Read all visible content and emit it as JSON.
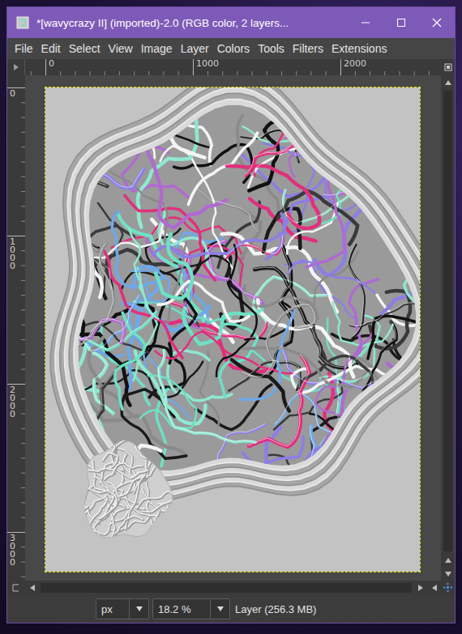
{
  "window": {
    "title": "*[wavycrazy II] (imported)-2.0 (RGB color, 2 layers..."
  },
  "menu": [
    "File",
    "Edit",
    "Select",
    "View",
    "Image",
    "Layer",
    "Colors",
    "Tools",
    "Filters",
    "Extensions"
  ],
  "rulers": {
    "horizontal": [
      "0",
      "1000",
      "2000"
    ],
    "vertical": [
      "0",
      "1000",
      "2000",
      "3000"
    ]
  },
  "status_bar": {
    "unit": "px",
    "zoom": "18.2 %",
    "info": "Layer (256.3 MB)"
  }
}
